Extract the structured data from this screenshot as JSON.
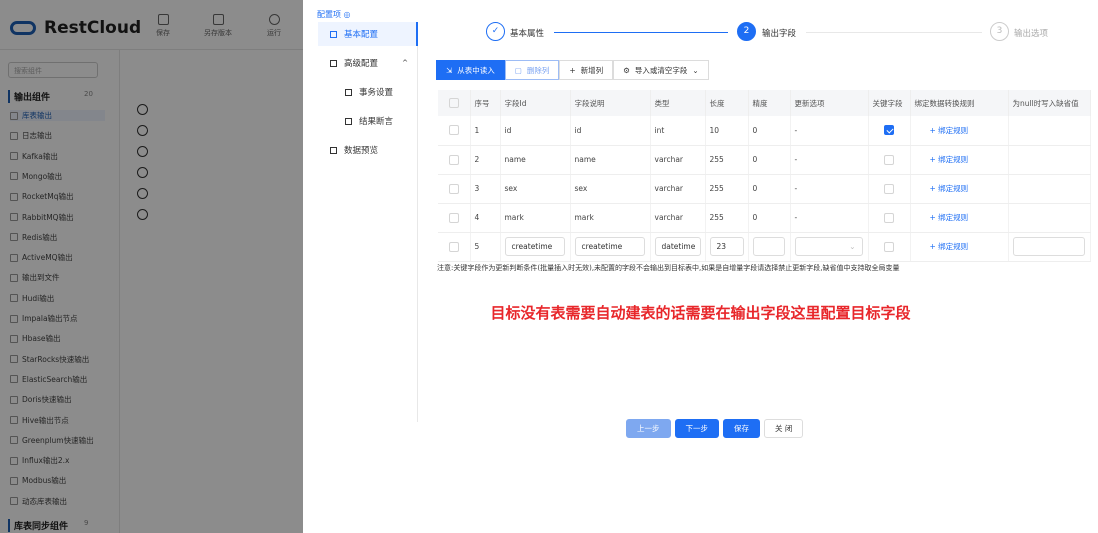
{
  "app": {
    "brand": "RestCloud",
    "toolbar": [
      "保存",
      "另存版本",
      "运行"
    ],
    "search_placeholder": "搜索组件",
    "groups": [
      {
        "label": "输出组件",
        "count": "20"
      },
      {
        "label": "库表同步组件",
        "count": "9"
      }
    ],
    "items": [
      "库表输出",
      "日志输出",
      "Kafka输出",
      "Mongo输出",
      "RocketMq输出",
      "RabbitMQ输出",
      "Redis输出",
      "ActiveMQ输出",
      "输出到文件",
      "Hudi输出",
      "Impala输出节点",
      "Hbase输出",
      "StarRocks快速输出",
      "ElasticSearch输出",
      "Doris快速输出",
      "Hive输出节点",
      "Greenplum快速输出",
      "Influx输出2.x",
      "Modbus输出",
      "动态库表输出"
    ]
  },
  "drawer": {
    "config_title": "配置项",
    "menu": [
      {
        "label": "基本配置"
      },
      {
        "label": "高级配置"
      },
      {
        "label": "事务设置"
      },
      {
        "label": "结果断言"
      },
      {
        "label": "数据预览"
      }
    ],
    "steps": [
      {
        "num": "✓",
        "label": "基本属性"
      },
      {
        "num": "2",
        "label": "输出字段"
      },
      {
        "num": "3",
        "label": "输出选项"
      }
    ],
    "toolbar": {
      "read": "从表中读入",
      "delete": "删除列",
      "add": "新增列",
      "import": "导入或清空字段"
    },
    "columns": [
      "",
      "序号",
      "字段Id",
      "字段说明",
      "类型",
      "长度",
      "精度",
      "更新选项",
      "关键字段",
      "绑定数据转换规则",
      "为null时写入缺省值"
    ],
    "rows": [
      {
        "no": "1",
        "id": "id",
        "desc": "id",
        "type": "int",
        "len": "10",
        "prec": "0",
        "upd": "-",
        "key": true
      },
      {
        "no": "2",
        "id": "name",
        "desc": "name",
        "type": "varchar",
        "len": "255",
        "prec": "0",
        "upd": "-",
        "key": false
      },
      {
        "no": "3",
        "id": "sex",
        "desc": "sex",
        "type": "varchar",
        "len": "255",
        "prec": "0",
        "upd": "-",
        "key": false
      },
      {
        "no": "4",
        "id": "mark",
        "desc": "mark",
        "type": "varchar",
        "len": "255",
        "prec": "0",
        "upd": "-",
        "key": false
      },
      {
        "no": "5",
        "id": "createtime",
        "desc": "createtime",
        "type": "datetime",
        "len": "23",
        "prec": "",
        "upd": "",
        "key": false
      }
    ],
    "bind_label": "+ 绑定规则",
    "note": "注意:关键字段作为更新判断条件(批量插入时无效),未配置的字段不会输出到目标表中,如果是自增量字段请选择禁止更新字段,缺省值中支持取全局变量",
    "annotation": "目标没有表需要自动建表的话需要在输出字段这里配置目标字段",
    "footer": {
      "prev": "上一步",
      "next": "下一步",
      "save": "保存",
      "close": "关 闭"
    }
  }
}
